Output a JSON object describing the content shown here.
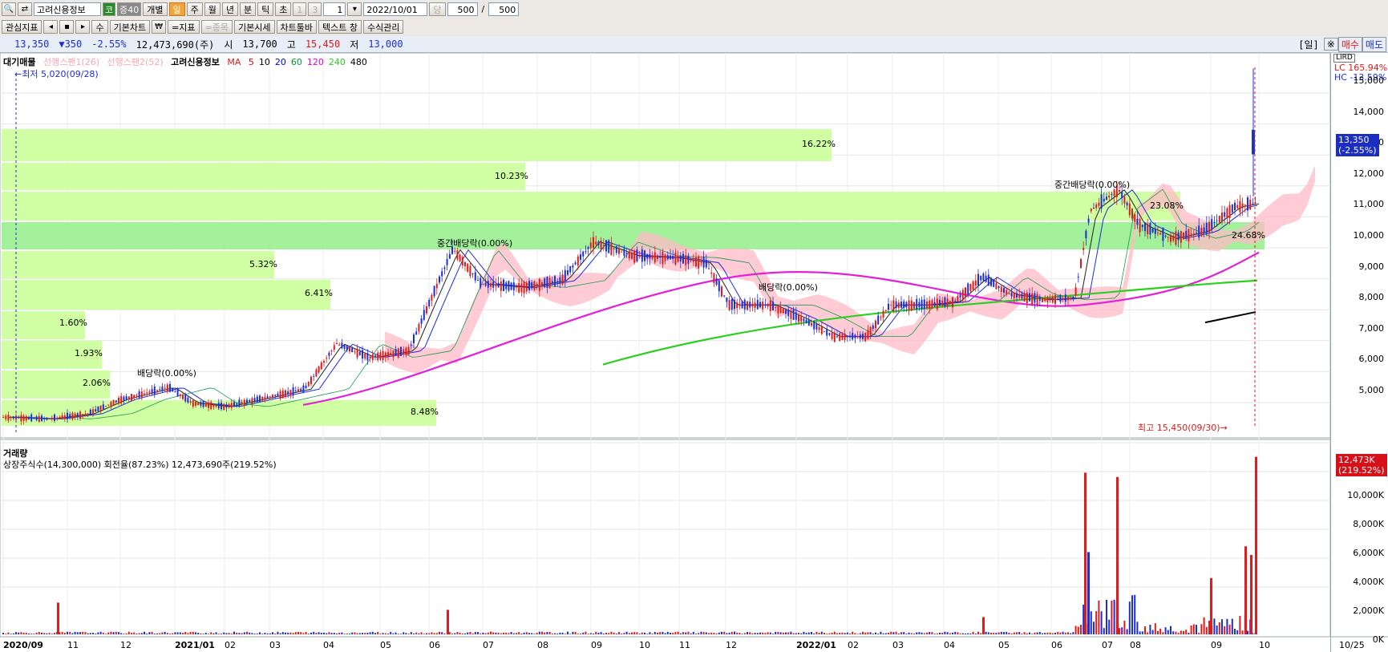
{
  "toolbar1": {
    "stock_name": "고려신용정보",
    "market_badge": "코",
    "credit_badge": "증40",
    "period_individual": "개별",
    "periods": [
      "일",
      "주",
      "월",
      "년",
      "분",
      "틱",
      "초"
    ],
    "nums": [
      "1",
      "3"
    ],
    "interval_value": "1",
    "date_value": "2022/10/01",
    "dang": "당",
    "count_value": "500",
    "slash": "/",
    "total_value": "500"
  },
  "toolbar2": {
    "items": [
      "관심지표",
      "◂",
      "▪",
      "▸",
      "수",
      "기본차트",
      "₩",
      "=지표",
      "=종목",
      "기본시세",
      "차트툴바",
      "텍스트 창",
      "수식관리"
    ]
  },
  "pricebar": {
    "price": "13,350",
    "change": "▼350",
    "change_pct": "-2.55%",
    "volume": "12,473,690(주)",
    "open_label": "시",
    "open": "13,700",
    "high_label": "고",
    "high": "15,450",
    "low_label": "저",
    "low": "13,000",
    "period_label": "[일]",
    "buy": "매수",
    "sell": "매도"
  },
  "indicators": {
    "daegi": "대기매물",
    "span1": "선행스팬1(26)",
    "span2": "선행스팬2(52)",
    "stock": "고려신용정보",
    "ma_label": "MA",
    "ma_periods": [
      {
        "label": "5",
        "color": "#e00000"
      },
      {
        "label": "10",
        "color": "#000000"
      },
      {
        "label": "20",
        "color": "#0000e0"
      },
      {
        "label": "60",
        "color": "#009a3a"
      },
      {
        "label": "120",
        "color": "#e000e0"
      },
      {
        "label": "240",
        "color": "#2bd01f"
      },
      {
        "label": "480",
        "color": "#000000"
      }
    ]
  },
  "annotations": {
    "low": "←최저 5,020(09/28)",
    "high": "최고 15,450(09/30)→",
    "dividend1": "배당락(0.00%)",
    "dividend2": "중간배당락(0.00%)",
    "dividend3": "배당락(0.00%)",
    "dividend4": "중간배당락(0.00%)"
  },
  "price_axis": {
    "labels": [
      "15,000",
      "14,000",
      "13,000",
      "12,000",
      "11,000",
      "10,000",
      "9,000",
      "8,000",
      "7,000",
      "6,000",
      "5,000"
    ],
    "lc": "LC 165.94%",
    "hc": "HC -13.59%",
    "current_tag": "13,350",
    "current_pct": "(-2.55%)",
    "lird": "LIRD"
  },
  "volume_profile": {
    "percentages": [
      "16.22%",
      "10.23%",
      "23.08%",
      "24.68%",
      "5.32%",
      "6.41%",
      "1.60%",
      "1.93%",
      "2.06%",
      "8.48%"
    ]
  },
  "volume_panel": {
    "title": "거래량",
    "info": "상장주식수(14,300,000) 회전율(87.23%) 12,473,690주(219.52%)",
    "axis_labels": [
      "10,000K",
      "8,000K",
      "6,000K",
      "4,000K",
      "2,000K",
      "0K"
    ],
    "tag_value": "12,473K",
    "tag_pct": "(219.52%)"
  },
  "x_axis": {
    "labels": [
      "2020/09",
      "11",
      "12",
      "2021/01",
      "02",
      "03",
      "04",
      "05",
      "06",
      "07",
      "08",
      "09",
      "10",
      "11",
      "12",
      "2022/01",
      "02",
      "03",
      "04",
      "05",
      "06",
      "07",
      "08",
      "09",
      "10"
    ],
    "right_label": "10/25"
  },
  "colors": {
    "up": "#e21a1a",
    "down": "#1d2fd1",
    "profile": "#ccff99",
    "profile_max": "#99f08f",
    "cloud": "#ffb9c6"
  }
}
